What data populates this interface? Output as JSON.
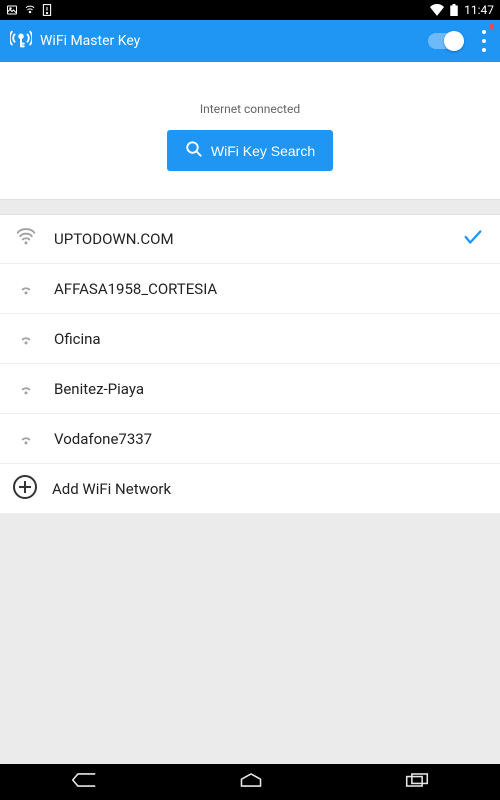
{
  "statusbar": {
    "time": "11:47"
  },
  "header": {
    "title": "WiFi Master Key"
  },
  "banner": {
    "status": "Internet connected",
    "search_label": "WiFi Key Search"
  },
  "wifi": {
    "items": [
      {
        "name": "UPTODOWN.COM",
        "connected": true,
        "strength": 4
      },
      {
        "name": "AFFASA1958_CORTESIA",
        "connected": false,
        "strength": 2
      },
      {
        "name": "Oficina",
        "connected": false,
        "strength": 2
      },
      {
        "name": "Benitez-Piaya",
        "connected": false,
        "strength": 2
      },
      {
        "name": "Vodafone7337",
        "connected": false,
        "strength": 2
      }
    ],
    "add_label": "Add WiFi Network"
  }
}
